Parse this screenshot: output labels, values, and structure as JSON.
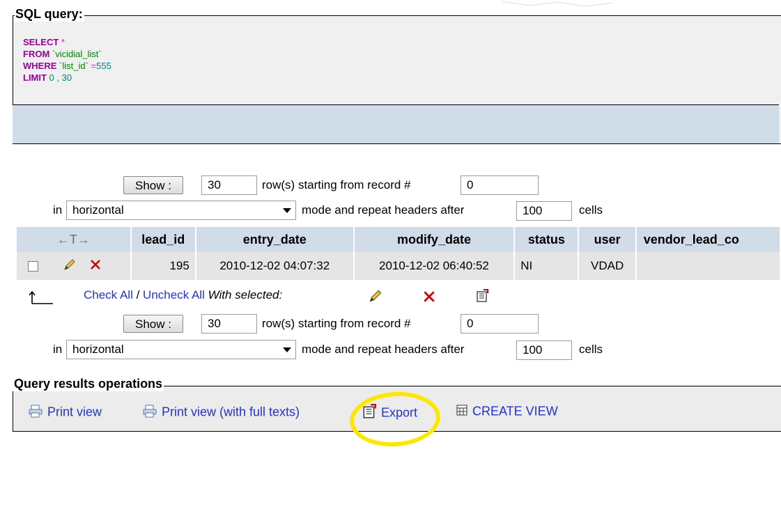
{
  "sql": {
    "legend": "SQL query:",
    "line1_kw": "SELECT",
    "line1_rest": " *",
    "line2_kw": "FROM",
    "line2_rest": " `vicidial_list`",
    "line3_kw": "WHERE",
    "line3_field": " `list_id`",
    "line3_op": " =",
    "line3_val": "555",
    "line4_kw": "LIMIT",
    "line4_rest": " 0 , 30"
  },
  "nav_top": {
    "show_label": "Show :",
    "rows_value": "30",
    "rows_text": "row(s) starting from record #",
    "start_value": "0",
    "in_label": "in",
    "mode_value": "horizontal",
    "repeat_text": "mode and repeat headers after",
    "repeat_value": "100",
    "cells_text": "cells"
  },
  "nav_bottom": {
    "show_label": "Show :",
    "rows_value": "30",
    "rows_text": "row(s) starting from record #",
    "start_value": "0",
    "in_label": "in",
    "mode_value": "horizontal",
    "repeat_text": "mode and repeat headers after",
    "repeat_value": "100",
    "cells_text": "cells"
  },
  "table": {
    "arrows": "←T→",
    "columns": [
      "lead_id",
      "entry_date",
      "modify_date",
      "status",
      "user",
      "vendor_lead_co"
    ],
    "rows": [
      {
        "lead_id": "195",
        "entry_date": "2010-12-02 04:07:32",
        "modify_date": "2010-12-02 06:40:52",
        "status": "NI",
        "user": "VDAD",
        "vendor_lead_co": ""
      }
    ]
  },
  "bulk": {
    "check_all": "Check All",
    "separator": " / ",
    "uncheck_all": "Uncheck All",
    "with_selected": "With selected:"
  },
  "ops": {
    "legend": "Query results operations",
    "print_view": "Print view",
    "print_view_full": "Print view (with full texts)",
    "export": "Export",
    "create_view": "CREATE VIEW"
  },
  "colors": {
    "header_bg": "#d0dce8",
    "row_bg": "#e5e5e5",
    "link": "#2233cc",
    "highlight": "#ffe600",
    "delete_red": "#cc0000"
  },
  "icons": [
    "pencil-icon",
    "delete-icon",
    "export-icon",
    "print-icon",
    "create-view-icon",
    "arrow-up-icon"
  ]
}
